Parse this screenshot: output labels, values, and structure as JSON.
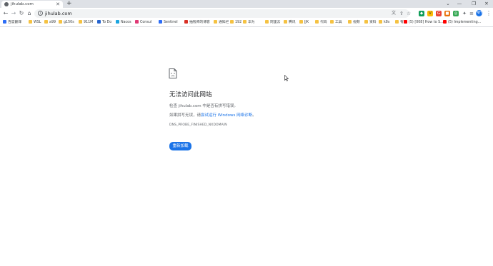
{
  "tab": {
    "title": "jihulab.com",
    "close": "✕",
    "new_tab": "+"
  },
  "window_controls": {
    "dropdown": "⌄",
    "minimize": "—",
    "restore": "❐",
    "close": "✕"
  },
  "toolbar": {
    "back": "←",
    "forward": "→",
    "reload": "↻",
    "home": "⌂",
    "url": "jihulab.com",
    "avatar_initials": "NH",
    "menu": "⋮"
  },
  "bookmarks": [
    {
      "label": "百度翻译",
      "icon": "translate-icon",
      "color": "#2d6df6"
    },
    {
      "label": "WSL",
      "icon": "folder-icon",
      "color": "#f5c242"
    },
    {
      "label": "a99",
      "icon": "folder-icon",
      "color": "#f5c242"
    },
    {
      "label": "g150s",
      "icon": "folder-icon",
      "color": "#f5c242"
    },
    {
      "label": "911M",
      "icon": "folder-icon",
      "color": "#f5c242"
    },
    {
      "label": "To Do",
      "icon": "todo-check-icon",
      "color": "#2564cf"
    },
    {
      "label": "Nacos",
      "icon": "nacos-icon",
      "color": "#1ba5e0"
    },
    {
      "label": "Consul",
      "icon": "consul-icon",
      "color": "#e03875"
    },
    {
      "label": "Sentinel",
      "icon": "sentinel-icon",
      "color": "#2d6df6"
    },
    {
      "label": "抽钱师的博客",
      "icon": "blog-icon",
      "color": "#d93025"
    },
    {
      "label": "通知栏",
      "icon": "folder-icon",
      "color": "#f5c242"
    },
    {
      "label": "192",
      "icon": "folder-icon",
      "color": "#f5c242"
    },
    {
      "label": "华为",
      "icon": "folder-icon",
      "color": "#f5c242"
    },
    {
      "label": "阿里云",
      "icon": "folder-icon",
      "color": "#f5c242"
    },
    {
      "label": "腾讯",
      "icon": "folder-icon",
      "color": "#f5c242"
    },
    {
      "label": "JJK",
      "icon": "folder-icon",
      "color": "#f5c242"
    },
    {
      "label": "代码",
      "icon": "folder-icon",
      "color": "#f5c242"
    },
    {
      "label": "工具",
      "icon": "folder-icon",
      "color": "#f5c242"
    },
    {
      "label": "视频",
      "icon": "folder-icon",
      "color": "#f5c242"
    },
    {
      "label": "资料",
      "icon": "folder-icon",
      "color": "#f5c242"
    },
    {
      "label": "k8s",
      "icon": "folder-icon",
      "color": "#f5c242"
    },
    {
      "label": "有",
      "icon": "folder-icon",
      "color": "#f5c242"
    },
    {
      "label": "(5) [008] How to S...",
      "icon": "youtube-icon",
      "color": "#ff0000"
    },
    {
      "label": "(5) Implementing...",
      "icon": "youtube-icon",
      "color": "#ff0000"
    }
  ],
  "error": {
    "title": "无法访问此网站",
    "check_prefix": "检查 ",
    "check_host": "jihulab.com",
    "check_suffix": " 中是否有拼写错误。",
    "retry_prefix": "如果拼写无误，请",
    "retry_link": "尝试运行 Windows 网络诊断",
    "retry_suffix": "。",
    "code": "DNS_PROBE_FINISHED_NXDOMAIN",
    "reload_button": "重新加载"
  },
  "colors": {
    "accent": "#1a73e8",
    "tabstrip": "#dee1e6",
    "omnibox": "#f1f3f4"
  }
}
